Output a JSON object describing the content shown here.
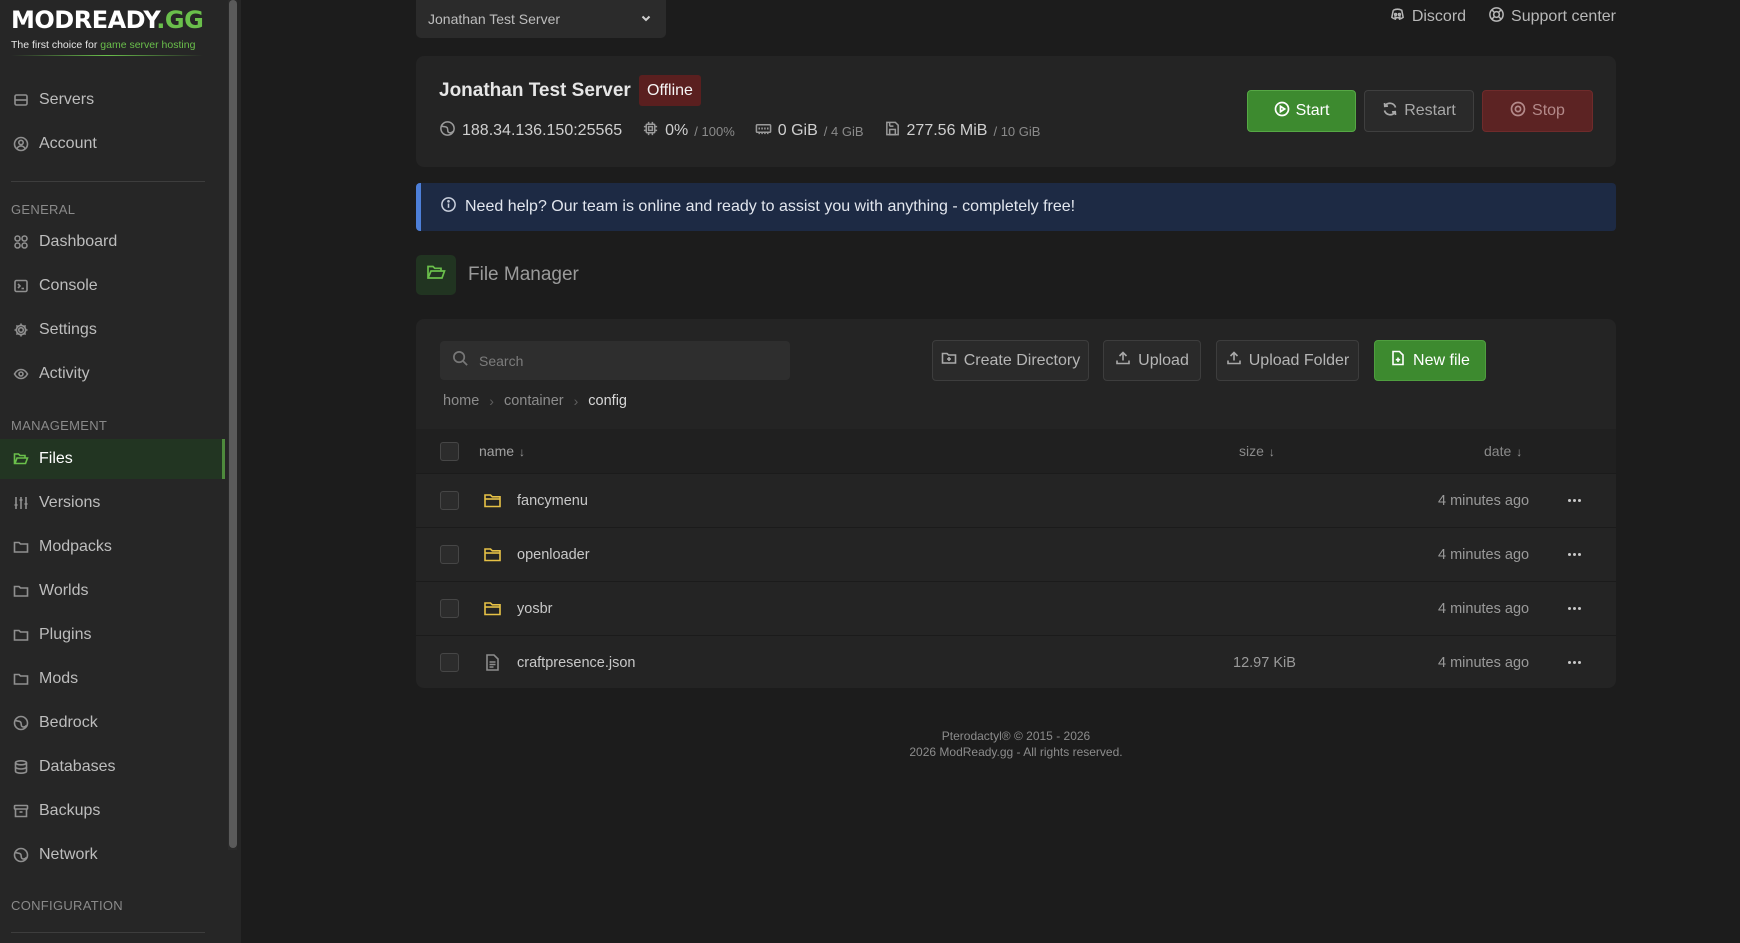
{
  "brand": {
    "logo_main": "MODREADY",
    "logo_suffix": ".GG",
    "tagline_prefix": "The first choice for ",
    "tagline_accent": "game server hosting",
    "accent_color": "#6abf4b"
  },
  "sidebar": {
    "top_items": [
      {
        "label": "Servers",
        "icon": "server-icon"
      },
      {
        "label": "Account",
        "icon": "user-circle-icon"
      }
    ],
    "sections": {
      "general": "GENERAL",
      "management": "MANAGEMENT",
      "configuration": "CONFIGURATION"
    },
    "general_items": [
      {
        "label": "Dashboard",
        "icon": "dashboard-grid-icon"
      },
      {
        "label": "Console",
        "icon": "terminal-icon"
      },
      {
        "label": "Settings",
        "icon": "gear-icon"
      },
      {
        "label": "Activity",
        "icon": "eye-icon"
      }
    ],
    "management_items": [
      {
        "label": "Files",
        "icon": "folder-open-icon",
        "active": true
      },
      {
        "label": "Versions",
        "icon": "sliders-icon"
      },
      {
        "label": "Modpacks",
        "icon": "folder-icon"
      },
      {
        "label": "Worlds",
        "icon": "folder-icon"
      },
      {
        "label": "Plugins",
        "icon": "folder-icon"
      },
      {
        "label": "Mods",
        "icon": "folder-icon"
      },
      {
        "label": "Bedrock",
        "icon": "globe-icon"
      },
      {
        "label": "Databases",
        "icon": "database-icon"
      },
      {
        "label": "Backups",
        "icon": "archive-icon"
      },
      {
        "label": "Network",
        "icon": "globe-icon"
      }
    ]
  },
  "header": {
    "server_select": "Jonathan Test Server",
    "links": [
      {
        "label": "Discord",
        "icon": "discord-icon"
      },
      {
        "label": "Support center",
        "icon": "lifebuoy-icon"
      }
    ]
  },
  "server": {
    "name": "Jonathan Test Server",
    "status": "Offline",
    "status_color": "#5a1f1f",
    "address": "188.34.136.150:25565",
    "cpu": "0%",
    "cpu_limit": "/ 100%",
    "memory": "0 GiB",
    "memory_limit": "/ 4 GiB",
    "disk": "277.56 MiB",
    "disk_limit": "/ 10 GiB",
    "buttons": {
      "start": "Start",
      "restart": "Restart",
      "stop": "Stop"
    }
  },
  "help_banner": "Need help? Our team is online and ready to assist you with anything - completely free!",
  "file_manager": {
    "title": "File Manager",
    "search_placeholder": "Search",
    "actions": {
      "create_directory": "Create Directory",
      "upload": "Upload",
      "upload_folder": "Upload Folder",
      "new_file": "New file"
    },
    "breadcrumb": [
      "home",
      "container",
      "config"
    ],
    "columns": {
      "name": "name",
      "size": "size",
      "date": "date",
      "sort_arrow": "↓"
    },
    "rows": [
      {
        "type": "folder",
        "name": "fancymenu",
        "size": "",
        "date": "4 minutes ago"
      },
      {
        "type": "folder",
        "name": "openloader",
        "size": "",
        "date": "4 minutes ago"
      },
      {
        "type": "folder",
        "name": "yosbr",
        "size": "",
        "date": "4 minutes ago"
      },
      {
        "type": "file",
        "name": "craftpresence.json",
        "size": "12.97 KiB",
        "date": "4 minutes ago"
      }
    ]
  },
  "footer": {
    "line1": "Pterodactyl® © 2015 - 2026",
    "line2": "2026 ModReady.gg - All rights reserved."
  }
}
